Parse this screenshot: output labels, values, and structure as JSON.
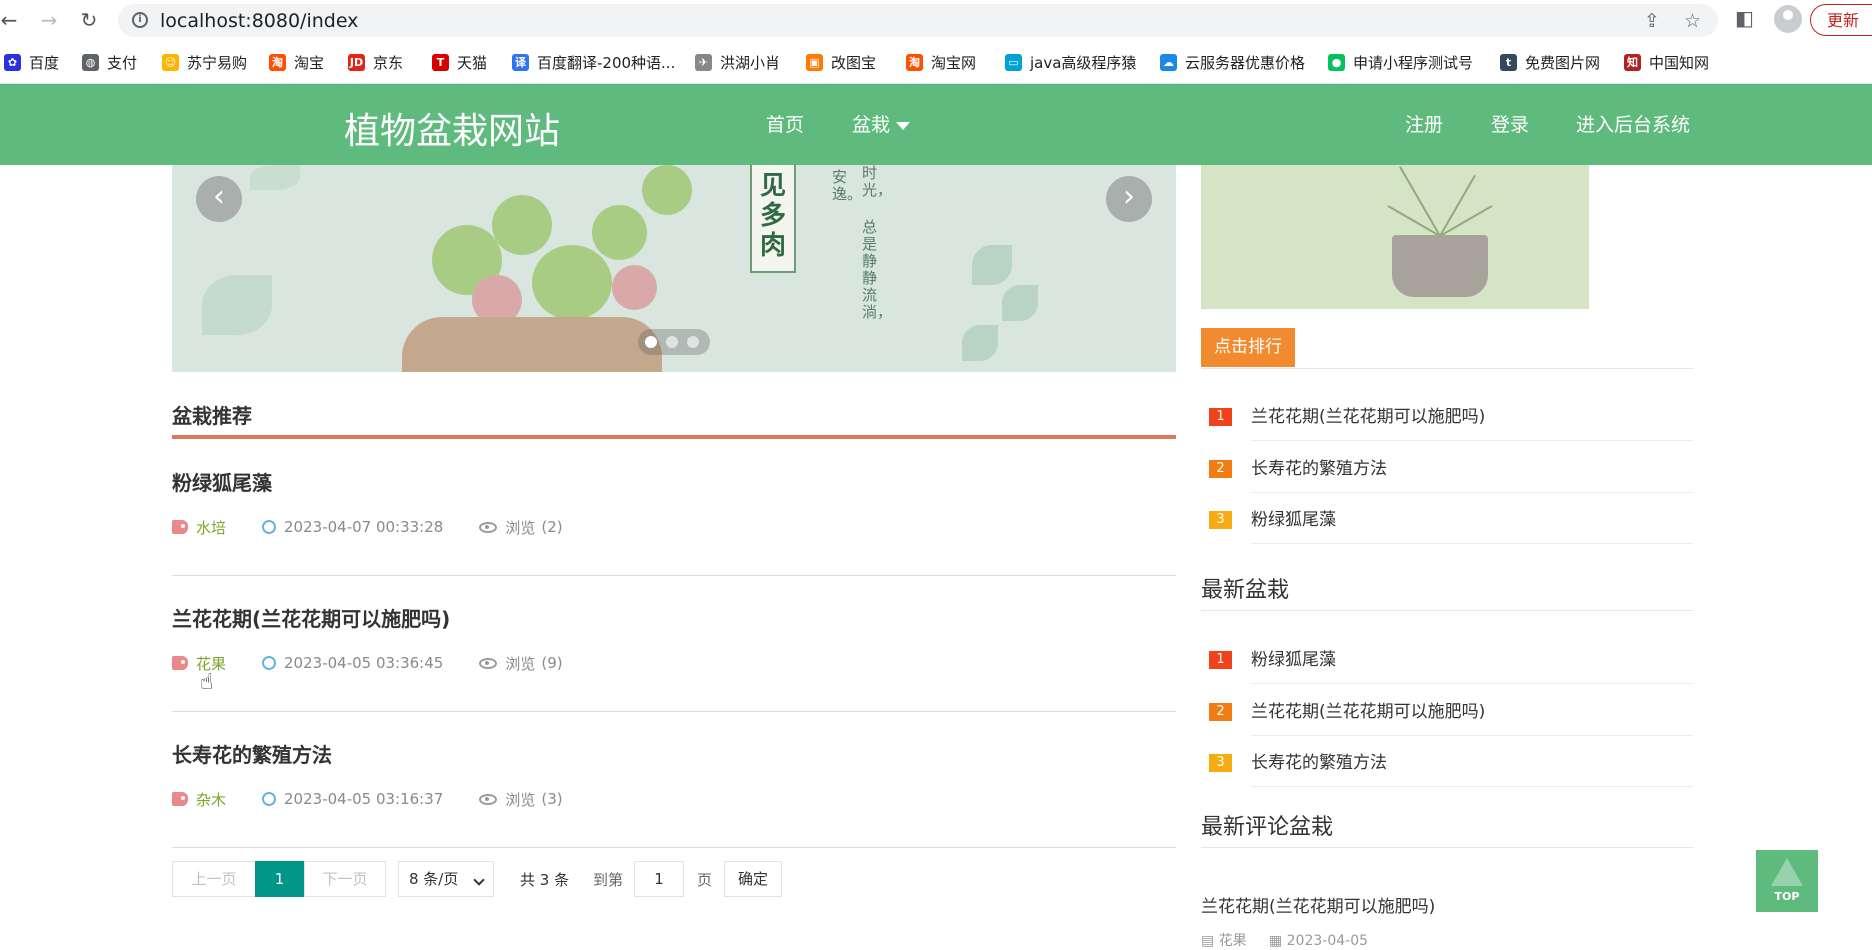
{
  "browser": {
    "url": "localhost:8080/index",
    "update_label": "更新",
    "bookmarks": [
      {
        "label": "百度",
        "icon": "baidu-icon",
        "color": "#2932e1",
        "glyph": "✿"
      },
      {
        "label": "支付",
        "icon": "globe-icon",
        "color": "#5f6368",
        "glyph": "◍"
      },
      {
        "label": "苏宁易购",
        "icon": "suning-icon",
        "color": "#ffb400",
        "glyph": "☺"
      },
      {
        "label": "淘宝",
        "icon": "taobao-icon",
        "color": "#ff5000",
        "glyph": "淘"
      },
      {
        "label": "京东",
        "icon": "jd-icon",
        "color": "#e1251b",
        "glyph": "JD"
      },
      {
        "label": "天猫",
        "icon": "tmall-icon",
        "color": "#d60000",
        "glyph": "T"
      },
      {
        "label": "百度翻译-200种语...",
        "icon": "translate-icon",
        "color": "#3372f0",
        "glyph": "译"
      },
      {
        "label": "洪湖小肖",
        "icon": "bird-icon",
        "color": "#888888",
        "glyph": "✈"
      },
      {
        "label": "改图宝",
        "icon": "image-tool-icon",
        "color": "#ff7a00",
        "glyph": "▣"
      },
      {
        "label": "淘宝网",
        "icon": "taobao-icon",
        "color": "#ff5000",
        "glyph": "淘"
      },
      {
        "label": "java高级程序猿",
        "icon": "bilibili-icon",
        "color": "#00a1d6",
        "glyph": "▭"
      },
      {
        "label": "云服务器优惠价格",
        "icon": "cloud-icon",
        "color": "#1e88e5",
        "glyph": "☁"
      },
      {
        "label": "申请小程序测试号",
        "icon": "wechat-icon",
        "color": "#07c160",
        "glyph": "●"
      },
      {
        "label": "免费图片网",
        "icon": "t-icon",
        "color": "#34495e",
        "glyph": "t"
      },
      {
        "label": "中国知网",
        "icon": "cnki-icon",
        "color": "#b22222",
        "glyph": "知"
      }
    ]
  },
  "site": {
    "logo": "植物盆栽网站",
    "nav": {
      "home": "首页",
      "bonsai": "盆栽"
    },
    "nav_right": {
      "register": "注册",
      "login": "登录",
      "admin": "进入后台系统"
    }
  },
  "carousel": {
    "sign_text": "见多肉",
    "vertical_1": "安逸。",
    "vertical_2": "时光，",
    "vertical_3": "总是静静流淌，",
    "prev_glyph": "‹",
    "next_glyph": "›"
  },
  "recommend": {
    "title": "盆栽推荐",
    "views_label": "浏览",
    "posts": [
      {
        "title": "粉绿狐尾藻",
        "category": "水培",
        "date": "2023-04-07 00:33:28",
        "views": "(2)"
      },
      {
        "title": "兰花花期(兰花花期可以施肥吗)",
        "category": "花果",
        "date": "2023-04-05 03:36:45",
        "views": "(9)"
      },
      {
        "title": "长寿花的繁殖方法",
        "category": "杂木",
        "date": "2023-04-05 03:16:37",
        "views": "(3)"
      }
    ]
  },
  "pagination": {
    "prev": "上一页",
    "current": "1",
    "next": "下一页",
    "page_size": "8 条/页",
    "total": "共 3 条",
    "goto": "到第",
    "goto_value": "1",
    "page_unit": "页",
    "confirm": "确定"
  },
  "sidebar": {
    "rank_label": "点击排行",
    "rank_items": [
      "兰花花期(兰花花期可以施肥吗)",
      "长寿花的繁殖方法",
      "粉绿狐尾藻"
    ],
    "latest_title": "最新盆栽",
    "latest_items": [
      "粉绿狐尾藻",
      "兰花花期(兰花花期可以施肥吗)",
      "长寿花的繁殖方法"
    ],
    "comments_title": "最新评论盆栽",
    "comment": {
      "title": "兰花花期(兰花花期可以施肥吗)",
      "category": "花果",
      "date": "2023-04-05"
    }
  },
  "back_to_top": "TOP"
}
